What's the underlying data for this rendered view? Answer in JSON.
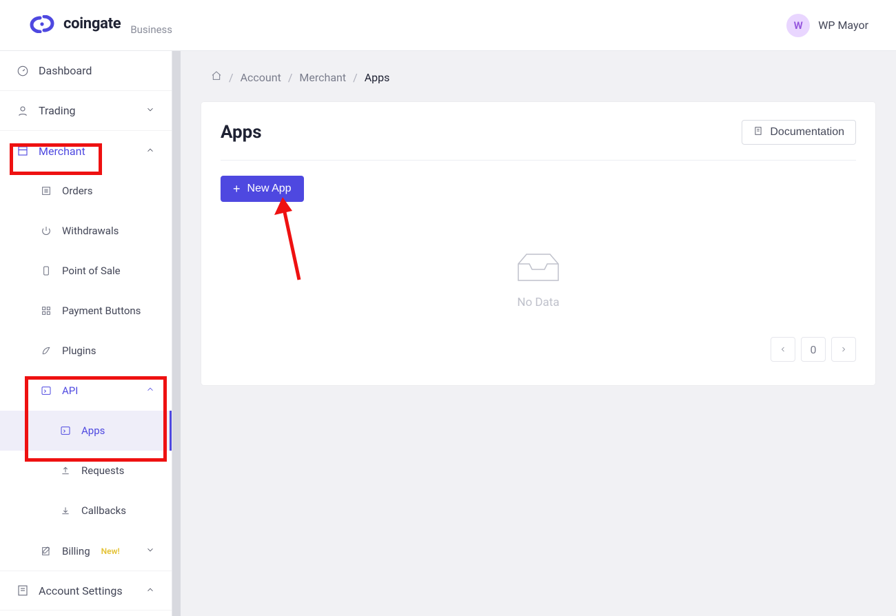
{
  "brand": {
    "word": "coingate",
    "sub": "Business"
  },
  "user": {
    "initial": "W",
    "name": "WP Mayor"
  },
  "sidebar": {
    "dashboard": "Dashboard",
    "trading": "Trading",
    "merchant": "Merchant",
    "orders": "Orders",
    "withdrawals": "Withdrawals",
    "pos": "Point of Sale",
    "payment_buttons": "Payment Buttons",
    "plugins": "Plugins",
    "api": "API",
    "apps": "Apps",
    "requests": "Requests",
    "callbacks": "Callbacks",
    "billing": "Billing",
    "billing_badge": "New!",
    "account_settings": "Account Settings"
  },
  "breadcrumb": {
    "account": "Account",
    "merchant": "Merchant",
    "apps": "Apps"
  },
  "main": {
    "title": "Apps",
    "doc_btn": "Documentation",
    "new_app": "New App",
    "no_data": "No Data",
    "page_num": "0"
  },
  "colors": {
    "accent": "#4e48e0",
    "highlight": "#e11"
  }
}
